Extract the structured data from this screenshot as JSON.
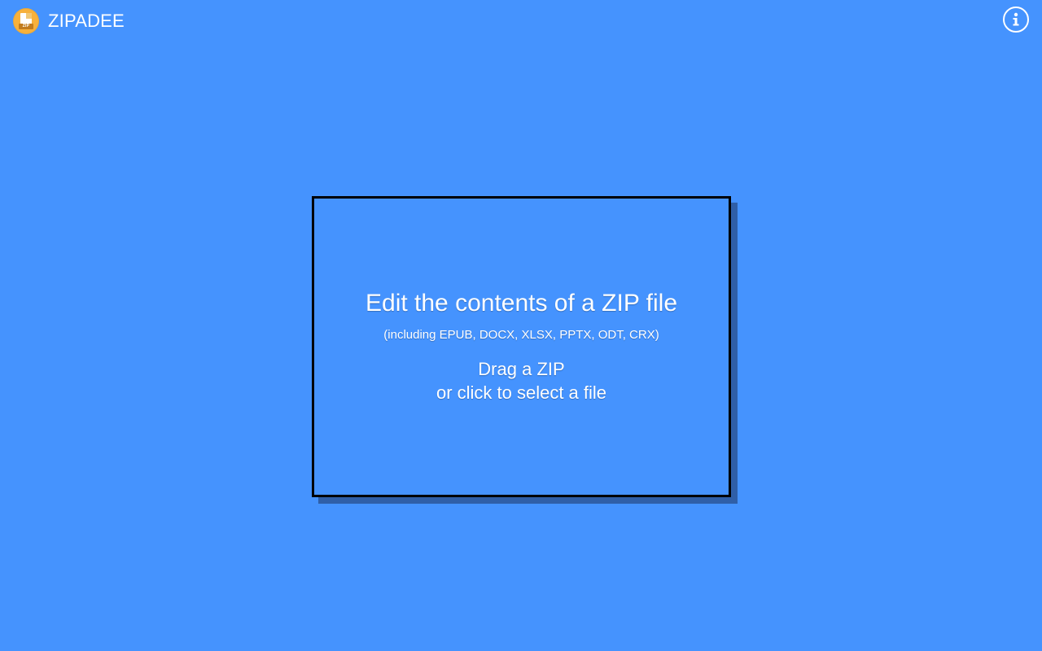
{
  "app": {
    "name": "ZIPADEE",
    "logo_icon": "zip-file-icon",
    "logo_tag": "ZIP"
  },
  "header": {
    "info_icon": "info-icon"
  },
  "dropzone": {
    "title": "Edit the contents of a ZIP file",
    "subtitle": "(including EPUB, DOCX, XLSX, PPTX, ODT, CRX)",
    "action_line1": "Drag a ZIP",
    "action_line2": "or click to select a file"
  },
  "colors": {
    "background": "#4593fe",
    "text": "#ffffff",
    "border": "#000000",
    "shadow": "#2f5fa8",
    "logo": "#f7b13c"
  }
}
